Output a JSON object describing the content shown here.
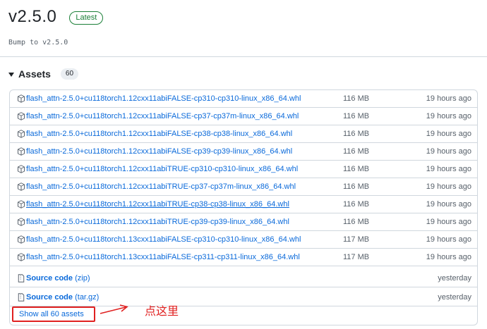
{
  "release": {
    "title": "v2.5.0",
    "latest_label": "Latest",
    "subtitle": "Bump to v2.5.0"
  },
  "assets": {
    "heading": "Assets",
    "count": "60",
    "items": [
      {
        "name": "flash_attn-2.5.0+cu118torch1.12cxx11abiFALSE-cp310-cp310-linux_x86_64.whl",
        "size": "116 MB",
        "time": "19 hours ago"
      },
      {
        "name": "flash_attn-2.5.0+cu118torch1.12cxx11abiFALSE-cp37-cp37m-linux_x86_64.whl",
        "size": "116 MB",
        "time": "19 hours ago"
      },
      {
        "name": "flash_attn-2.5.0+cu118torch1.12cxx11abiFALSE-cp38-cp38-linux_x86_64.whl",
        "size": "116 MB",
        "time": "19 hours ago"
      },
      {
        "name": "flash_attn-2.5.0+cu118torch1.12cxx11abiFALSE-cp39-cp39-linux_x86_64.whl",
        "size": "116 MB",
        "time": "19 hours ago"
      },
      {
        "name": "flash_attn-2.5.0+cu118torch1.12cxx11abiTRUE-cp310-cp310-linux_x86_64.whl",
        "size": "116 MB",
        "time": "19 hours ago"
      },
      {
        "name": "flash_attn-2.5.0+cu118torch1.12cxx11abiTRUE-cp37-cp37m-linux_x86_64.whl",
        "size": "116 MB",
        "time": "19 hours ago"
      },
      {
        "name": "flash_attn-2.5.0+cu118torch1.12cxx11abiTRUE-cp38-cp38-linux_x86_64.whl",
        "size": "116 MB",
        "time": "19 hours ago"
      },
      {
        "name": "flash_attn-2.5.0+cu118torch1.12cxx11abiTRUE-cp39-cp39-linux_x86_64.whl",
        "size": "116 MB",
        "time": "19 hours ago"
      },
      {
        "name": "flash_attn-2.5.0+cu118torch1.13cxx11abiFALSE-cp310-cp310-linux_x86_64.whl",
        "size": "117 MB",
        "time": "19 hours ago"
      },
      {
        "name": "flash_attn-2.5.0+cu118torch1.13cxx11abiFALSE-cp311-cp311-linux_x86_64.whl",
        "size": "117 MB",
        "time": "19 hours ago"
      }
    ],
    "source_zip": {
      "label": "Source code",
      "ext": "(zip)",
      "time": "yesterday"
    },
    "source_tar": {
      "label": "Source code",
      "ext": "(tar.gz)",
      "time": "yesterday"
    },
    "show_all": "Show all 60 assets"
  },
  "annotation": {
    "text": "点这里",
    "color": "#e02020"
  },
  "icons": {
    "package": "package-icon",
    "file_zip": "file-zip-icon",
    "caret": "triangle-down-icon"
  }
}
